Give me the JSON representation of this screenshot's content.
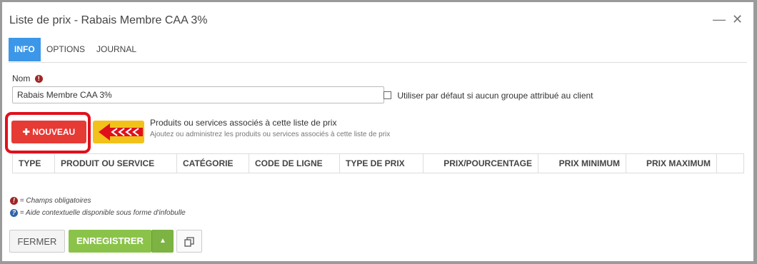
{
  "dialog": {
    "title": "Liste de prix - Rabais Membre CAA 3%",
    "minimize_glyph": "—",
    "close_glyph": "✕"
  },
  "tabs": [
    {
      "label": "INFO"
    },
    {
      "label": "OPTIONS"
    },
    {
      "label": "JOURNAL"
    }
  ],
  "form": {
    "nom_label": "Nom",
    "nom_value": "Rabais Membre CAA 3%",
    "default_checkbox_label": "Utiliser par défaut si aucun groupe attribué au client"
  },
  "associated": {
    "new_button": "NOUVEAU",
    "title": "Produits ou services associés à cette liste de prix",
    "subtitle": "Ajoutez ou administrez les produits ou services associés à cette liste de prix"
  },
  "table": {
    "columns": [
      "TYPE",
      "PRODUIT OU SERVICE",
      "CATÉGORIE",
      "CODE DE LIGNE",
      "TYPE DE PRIX",
      "PRIX/POURCENTAGE",
      "PRIX MINIMUM",
      "PRIX MAXIMUM",
      ""
    ]
  },
  "legend": {
    "required": "= Champs obligatoires",
    "help": "= Aide contextuelle disponible sous forme d'infobulle"
  },
  "footer": {
    "close_label": "FERMER",
    "save_label": "ENREGISTRER"
  },
  "colors": {
    "accent": "#3c97e8",
    "danger": "#e63a35",
    "save": "#8bc34a",
    "highlight": "#e0101b"
  }
}
